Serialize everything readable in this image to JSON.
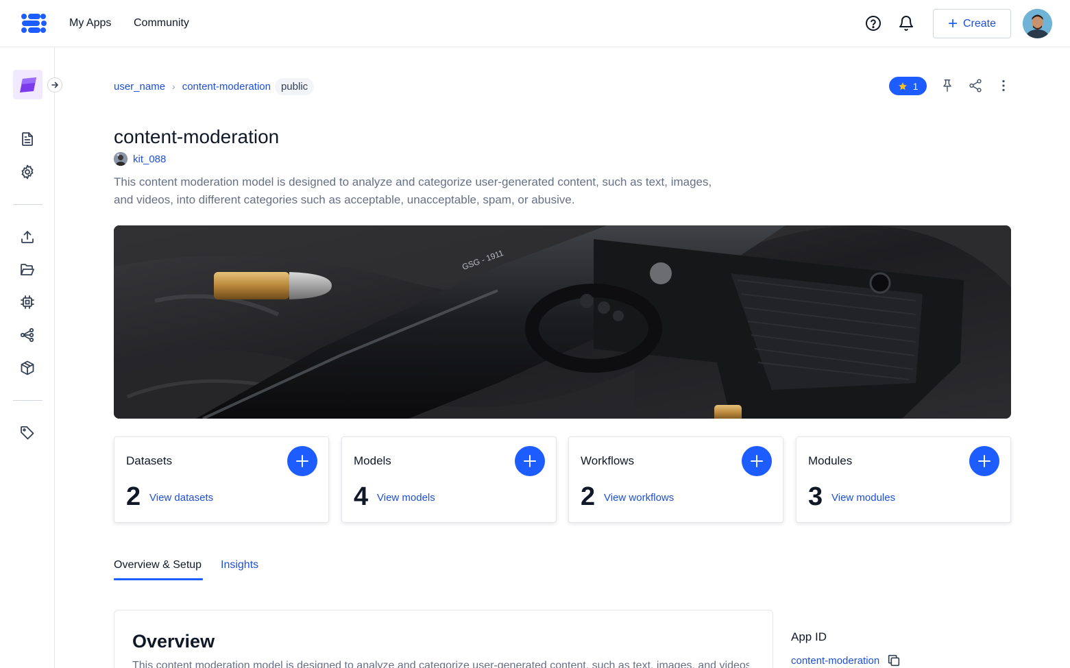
{
  "nav": {
    "links": [
      "My Apps",
      "Community"
    ],
    "create_label": "Create",
    "accent": "#1d5cff"
  },
  "breadcrumb": {
    "user": "user_name",
    "app": "content-moderation",
    "visibility": "public"
  },
  "actions": {
    "star_count": "1"
  },
  "app": {
    "title": "content-moderation",
    "owner": "kit_088",
    "description": "This content moderation model is designed to analyze and categorize user-generated content, such as text, images, and videos, into different categories such as acceptable, unacceptable, spam, or abusive."
  },
  "stats": [
    {
      "label": "Datasets",
      "count": "2",
      "link": "View datasets"
    },
    {
      "label": "Models",
      "count": "4",
      "link": "View models"
    },
    {
      "label": "Workflows",
      "count": "2",
      "link": "View workflows"
    },
    {
      "label": "Modules",
      "count": "3",
      "link": "View modules"
    }
  ],
  "tabs": [
    {
      "label": "Overview & Setup",
      "active": true
    },
    {
      "label": "Insights",
      "active": false
    }
  ],
  "overview": {
    "title": "Overview",
    "text": "This content moderation model is designed to analyze and categorize user-generated content, such as text, images, and videos, into different categories such as acceptable, unacceptable, spam, or abusive."
  },
  "app_id": {
    "label": "App ID",
    "value": "content-moderation"
  }
}
